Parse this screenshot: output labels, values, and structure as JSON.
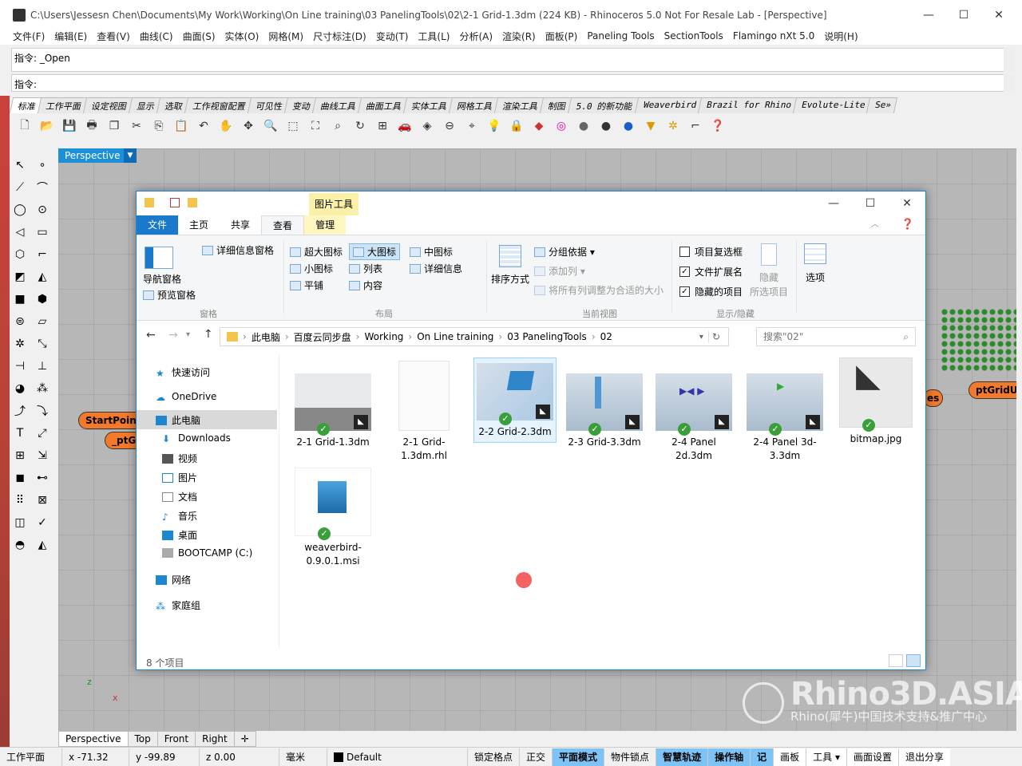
{
  "window": {
    "title": "C:\\Users\\Jessesn Chen\\Documents\\My Work\\Working\\On Line training\\03 PanelingTools\\02\\2-1 Grid-1.3dm (224 KB) - Rhinoceros 5.0 Not For Resale Lab - [Perspective]",
    "min": "—",
    "max": "☐",
    "close": "✕"
  },
  "menu": [
    "文件(F)",
    "编辑(E)",
    "查看(V)",
    "曲线(C)",
    "曲面(S)",
    "实体(O)",
    "网格(M)",
    "尺寸标注(D)",
    "变动(T)",
    "工具(L)",
    "分析(A)",
    "渲染(R)",
    "面板(P)",
    "Paneling Tools",
    "SectionTools",
    "Flamingo nXt 5.0",
    "说明(H)"
  ],
  "command": {
    "history": "指令: _Open",
    "prompt": "指令:"
  },
  "toolbar_tabs": [
    "标准",
    "工作平面",
    "设定视图",
    "显示",
    "选取",
    "工作视窗配置",
    "可见性",
    "变动",
    "曲线工具",
    "曲面工具",
    "实体工具",
    "网格工具",
    "渲染工具",
    "制图",
    "5.0 的新功能",
    "Weaverbird",
    "Brazil for Rhino",
    "Evolute-Lite",
    "Se»"
  ],
  "toolbar_icons": [
    "new-file",
    "open-folder",
    "save",
    "print",
    "copy-page",
    "cut",
    "copy",
    "paste",
    "undo",
    "pan-hand",
    "move",
    "zoom",
    "zoom-window",
    "zoom-extents",
    "zoom-selected",
    "rotate",
    "grid",
    "car",
    "lock-view",
    "target",
    "snap",
    "lightbulb",
    "lock",
    "layers",
    "color-wheel",
    "sphere-matte",
    "sphere-shiny",
    "sphere-blue",
    "render",
    "settings",
    "dimension",
    "help"
  ],
  "viewport": {
    "label": "Perspective",
    "nodes": [
      "StartPoin",
      "_ptG",
      "ptGridU",
      "es"
    ],
    "axis_z": "z",
    "axis_x": "x"
  },
  "watermark": {
    "big": "Rhino3D.ASIA",
    "small": "Rhino(犀牛)中国技术支持&推广中心"
  },
  "viewport_tabs": [
    "Perspective",
    "Top",
    "Front",
    "Right",
    "✛"
  ],
  "status": {
    "cplane": "工作平面",
    "x": "x -71.32",
    "y": "y -99.89",
    "z": "z 0.00",
    "unit": "毫米",
    "layer": "Default",
    "toggles": [
      "锁定格点",
      "正交",
      "平面模式",
      "物件锁点",
      "智慧轨迹",
      "操作轴",
      "记"
    ],
    "right": [
      "画板",
      "工具 ▾",
      "画面设置",
      "退出分享"
    ]
  },
  "explorer": {
    "picture_tools": "图片工具",
    "tabs": [
      "文件",
      "主页",
      "共享",
      "查看",
      "管理"
    ],
    "ribbon": {
      "pane": {
        "nav": "导航窗格",
        "preview": "预览窗格",
        "details": "详细信息窗格",
        "label": "窗格"
      },
      "layout": {
        "items": [
          "超大图标",
          "大图标",
          "中图标",
          "小图标",
          "列表",
          "详细信息",
          "平铺",
          "内容"
        ],
        "label": "布局"
      },
      "view": {
        "sort": "排序方式",
        "group": "分组依据 ▾",
        "add_col": "添加列 ▾",
        "fit": "将所有列调整为合适的大小",
        "label": "当前视图"
      },
      "show": {
        "item_check": "项目复选框",
        "ext": "文件扩展名",
        "hidden": "隐藏的项目",
        "hide_sel1": "隐藏",
        "hide_sel2": "所选项目",
        "label": "显示/隐藏"
      },
      "options": "选项"
    },
    "address": [
      "此电脑",
      "百度云同步盘",
      "Working",
      "On Line training",
      "03 PanelingTools",
      "02"
    ],
    "search_placeholder": "搜索\"02\"",
    "nav": [
      {
        "label": "快速访问"
      },
      {
        "label": "OneDrive"
      },
      {
        "label": "此电脑"
      },
      {
        "label": "Downloads"
      },
      {
        "label": "视频"
      },
      {
        "label": "图片"
      },
      {
        "label": "文档"
      },
      {
        "label": "音乐"
      },
      {
        "label": "桌面"
      },
      {
        "label": "BOOTCAMP (C:)"
      },
      {
        "label": "网络"
      },
      {
        "label": "家庭组"
      }
    ],
    "files": [
      {
        "name": "2-1 Grid-1.3dm"
      },
      {
        "name": "2-1 Grid-1.3dm.rhl"
      },
      {
        "name": "2-2 Grid-2.3dm"
      },
      {
        "name": "2-3 Grid-3.3dm"
      },
      {
        "name": "2-4 Panel 2d.3dm"
      },
      {
        "name": "2-4 Panel 3d-3.3dm"
      },
      {
        "name": "bitmap.jpg"
      },
      {
        "name": "weaverbird-0.9.0.1.msi"
      }
    ],
    "count": "8 个项目"
  }
}
